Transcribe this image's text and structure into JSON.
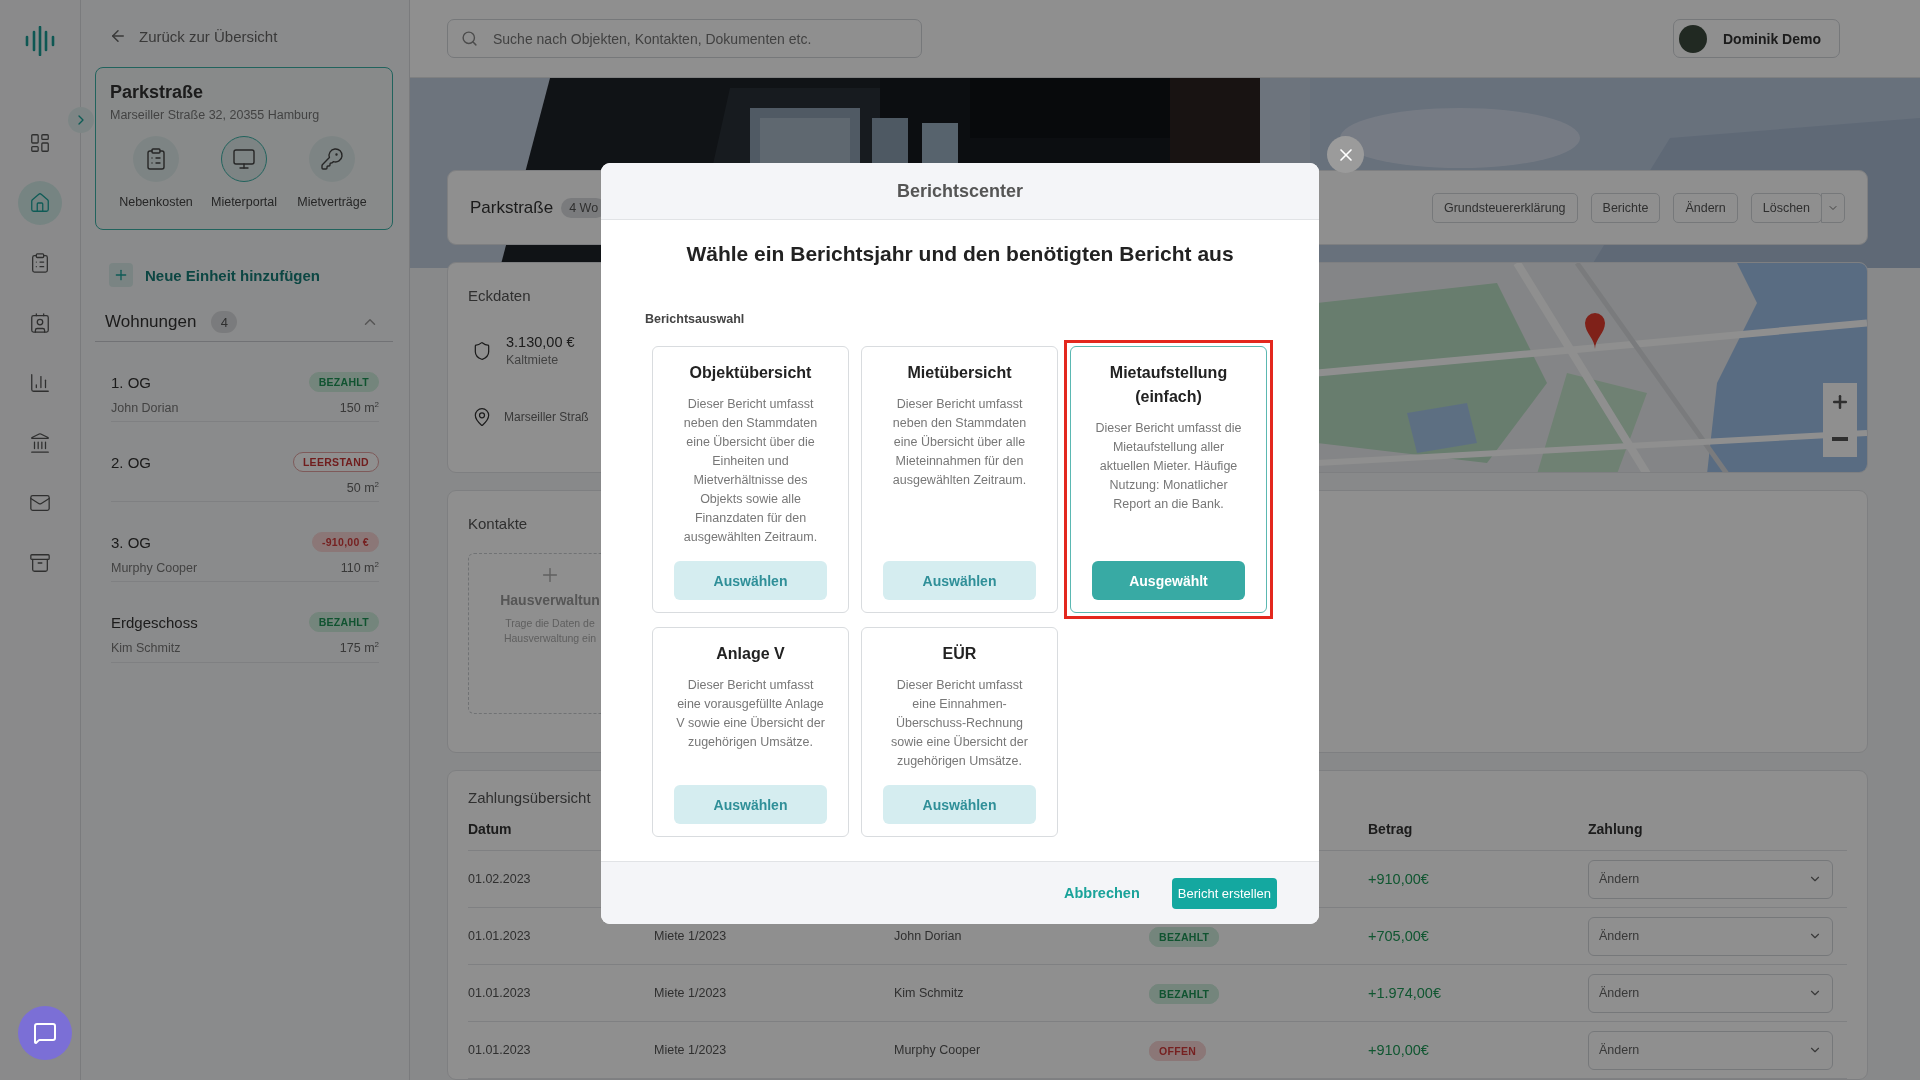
{
  "rail": {
    "items": [
      {
        "kind": "dashboard",
        "selected": false
      },
      {
        "kind": "home",
        "selected": true
      },
      {
        "kind": "costs",
        "selected": false
      },
      {
        "kind": "contacts",
        "selected": false
      },
      {
        "kind": "stats",
        "selected": false
      },
      {
        "kind": "bank",
        "selected": false
      },
      {
        "kind": "mail",
        "selected": false
      },
      {
        "kind": "archive",
        "selected": false
      }
    ]
  },
  "panel": {
    "back_link": "Zurück zur Übersicht",
    "property": {
      "title": "Parkstraße",
      "address": "Marseiller Straße 32, 20355 Hamburg",
      "actions": [
        {
          "label": "Nebenkosten",
          "kind": "costs",
          "selected": false
        },
        {
          "label": "Mieterportal",
          "kind": "portal",
          "selected": true
        },
        {
          "label": "Mietverträge",
          "kind": "contracts",
          "selected": false
        }
      ]
    },
    "add_unit": "Neue Einheit hinzufügen",
    "units_section": {
      "title": "Wohnungen",
      "count": "4",
      "expanded": true
    },
    "units": [
      {
        "name": "1. OG",
        "tenant": "John Dorian",
        "area": "150 m$^{2}$",
        "badge": {
          "label": "BEZAHLT",
          "kind": "paid"
        }
      },
      {
        "name": "2. OG",
        "area": "50 m$^{2}$",
        "badge": {
          "label": "LEERSTAND",
          "kind": "vacant"
        }
      },
      {
        "name": "3. OG",
        "tenant": "Murphy Cooper",
        "area": "110 m$^{2}$",
        "badge": {
          "label": "-910,00 €",
          "kind": "debt"
        }
      },
      {
        "name": "Erdgeschoss",
        "tenant": "Kim Schmitz",
        "area": "175 m$^{2}$",
        "badge": {
          "label": "BEZAHLT",
          "kind": "paid"
        }
      }
    ]
  },
  "topbar": {
    "search": {
      "placeholder": "Suche nach Objekten, Kontakten, Dokumenten etc."
    },
    "user": "Dominik Demo"
  },
  "header": {
    "title": "Parkstraße",
    "badge": "4 Wo",
    "actions": [
      "Grundsteuererklärung",
      "Berichte",
      "Ändern",
      "Löschen"
    ]
  },
  "key_data": {
    "title": "Eckdaten",
    "rent_value": "3.130,00 €",
    "rent_label": "Kaltmiete",
    "address": "Marseiller Straß"
  },
  "contacts": {
    "title": "Kontakte",
    "empty_card": {
      "title": "Hausverwaltun",
      "lines": [
        "Trage die Daten de",
        "Hausverwaltung ein"
      ]
    }
  },
  "payments": {
    "title": "Zahlungsübersicht",
    "header": {
      "date": "Datum",
      "amount": "Betrag",
      "payment": "Zahlung"
    },
    "rows": [
      {
        "date": "01.02.2023",
        "amount": "+910,00€",
        "payment": "Ändern"
      },
      {
        "date": "01.01.2023",
        "purpose": "Miete 1/2023",
        "tenant": "John Dorian",
        "status": {
          "label": "BEZAHLT",
          "kind": "paid"
        },
        "amount": "+705,00€",
        "payment": "Ändern"
      },
      {
        "date": "01.01.2023",
        "purpose": "Miete 1/2023",
        "tenant": "Kim Schmitz",
        "status": {
          "label": "BEZAHLT",
          "kind": "paid"
        },
        "amount": "+1.974,00€",
        "payment": "Ändern"
      },
      {
        "date": "01.01.2023",
        "purpose": "Miete 1/2023",
        "tenant": "Murphy Cooper",
        "status": {
          "label": "OFFEN",
          "kind": "open"
        },
        "amount": "+910,00€",
        "payment": "Ändern"
      }
    ]
  },
  "modal": {
    "title": "Berichtscenter",
    "heading": "Wähle ein Berichtsjahr und den benötigten Bericht aus",
    "section_label": "Berichtsauswahl",
    "reports": [
      {
        "title": "Objektübersicht",
        "description": "Dieser Bericht umfasst neben den Stammdaten eine Übersicht über die Einheiten und Mietverhältnisse des Objekts sowie alle Finanzdaten für den ausgewählten Zeitraum.",
        "button": "Auswählen",
        "selected": false
      },
      {
        "title": "Mietübersicht",
        "description": "Dieser Bericht umfasst neben den Stammdaten eine Übersicht über alle Mieteinnahmen für den ausgewählten Zeitraum.",
        "button": "Auswählen",
        "selected": false
      },
      {
        "title": "Mietaufstellung (einfach)",
        "description": "Dieser Bericht umfasst die Mietaufstellung aller aktuellen Mieter. Häufige Nutzung: Monatlicher Report an die Bank.",
        "button": "Ausgewählt",
        "selected": true
      },
      {
        "title": "Anlage V",
        "description": "Dieser Bericht umfasst eine vorausgefüllte Anlage V sowie eine Übersicht der zugehörigen Umsätze.",
        "button": "Auswählen",
        "selected": false
      },
      {
        "title": "EÜR",
        "description": "Dieser Bericht umfasst eine Einnahmen-Überschuss-Rechnung sowie eine Übersicht der zugehörigen Umsätze.",
        "button": "Auswählen",
        "selected": false
      }
    ],
    "cancel": "Abbrechen",
    "submit": "Bericht erstellen"
  }
}
